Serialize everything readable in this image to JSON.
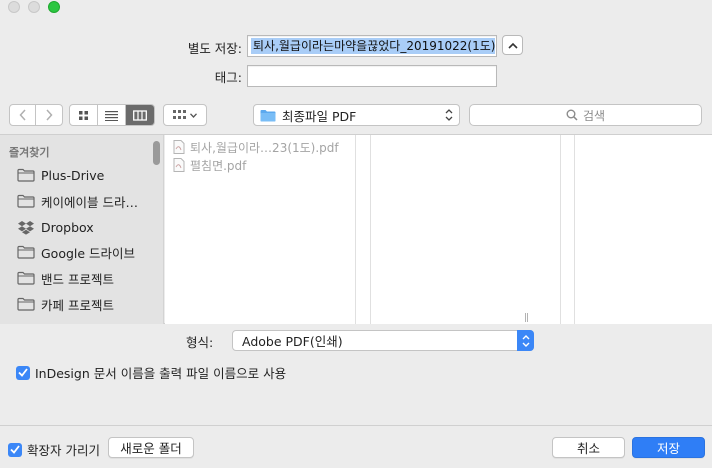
{
  "window": {
    "controls": [
      "close",
      "minimize",
      "zoom"
    ]
  },
  "save": {
    "label": "별도 저장:",
    "filename": "퇴사,월급이라는마약을끊었다_20191022(1도)",
    "tags_label": "태그:",
    "tags_value": ""
  },
  "toolbar": {
    "location": "최종파일 PDF",
    "search_placeholder": "검색"
  },
  "sidebar": {
    "header": "즐겨찾기",
    "items": [
      {
        "label": "Plus-Drive",
        "icon": "folder-icon"
      },
      {
        "label": "케이에이블 드라…",
        "icon": "folder-icon"
      },
      {
        "label": "Dropbox",
        "icon": "dropbox-icon"
      },
      {
        "label": "Google 드라이브",
        "icon": "folder-icon"
      },
      {
        "label": "밴드 프로젝트",
        "icon": "folder-icon"
      },
      {
        "label": "카페 프로젝트",
        "icon": "folder-icon"
      }
    ]
  },
  "files": [
    {
      "name": "퇴사,월급이라…23(1도).pdf",
      "icon": "pdf-file-icon"
    },
    {
      "name": "펼침면.pdf",
      "icon": "pdf-file-icon"
    }
  ],
  "format": {
    "label": "형식:",
    "value": "Adobe PDF(인쇄)"
  },
  "options": {
    "indesign_name_label": "InDesign 문서 이름을 출력 파일 이름으로 사용",
    "indesign_name_checked": true,
    "hide_extension_label": "확장자 가리기",
    "hide_extension_checked": true
  },
  "buttons": {
    "new_folder": "새로운 폴더",
    "cancel": "취소",
    "save": "저장"
  },
  "colors": {
    "accent": "#3b87f7",
    "primary_button": "#2f7ef6",
    "selection": "#a9cdf7",
    "zoom_light": "#2bc640"
  }
}
